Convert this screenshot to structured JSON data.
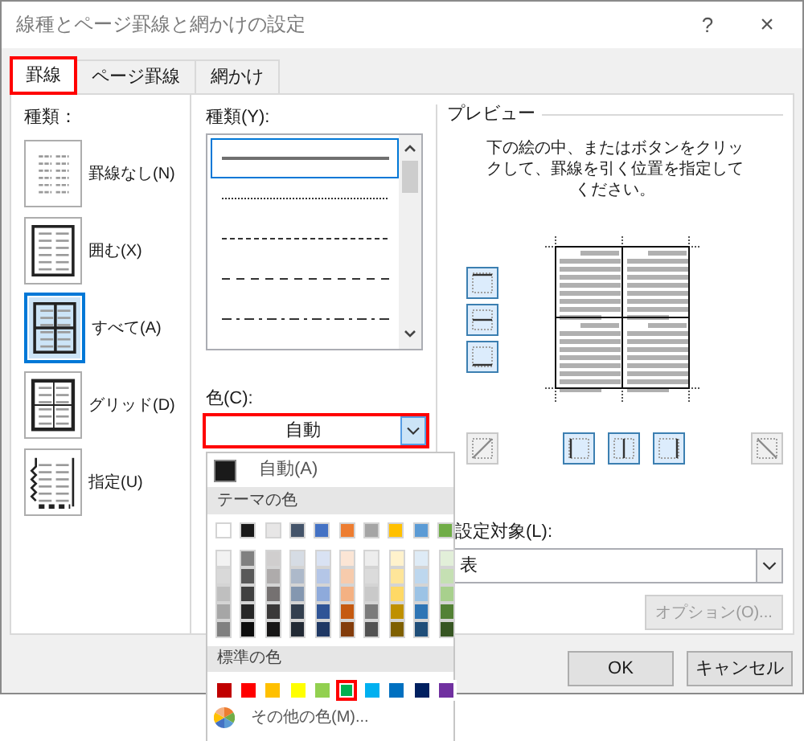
{
  "window": {
    "title": "線種とページ罫線と網かけの設定",
    "help": "?",
    "close": "×"
  },
  "tabs": [
    {
      "label": "罫線",
      "selected": true,
      "highlight": true
    },
    {
      "label": "ページ罫線",
      "selected": false,
      "highlight": false
    },
    {
      "label": "網かけ",
      "selected": false,
      "highlight": false
    }
  ],
  "setting": {
    "label": "種類：",
    "items": [
      {
        "kind": "none",
        "label": "罫線なし(N)",
        "selected": false
      },
      {
        "kind": "box",
        "label": "囲む(X)",
        "selected": false
      },
      {
        "kind": "all",
        "label": "すべて(A)",
        "selected": true
      },
      {
        "kind": "grid",
        "label": "グリッド(D)",
        "selected": false
      },
      {
        "kind": "custom",
        "label": "指定(U)",
        "selected": false
      }
    ]
  },
  "style": {
    "label": "種類(Y):",
    "items": [
      {
        "kind": "solid",
        "selected": true
      },
      {
        "kind": "dotted",
        "selected": false
      },
      {
        "kind": "dashed",
        "selected": false
      },
      {
        "kind": "long-dash",
        "selected": false
      },
      {
        "kind": "dash-dot",
        "selected": false
      }
    ]
  },
  "color": {
    "label": "色(C):",
    "value": "自動",
    "highlight": true,
    "expanded": true
  },
  "color_menu": {
    "automatic": {
      "label": "自動(A)",
      "color": "#1a1a1a",
      "selected": false
    },
    "theme_header": "テーマの色",
    "theme_colors": [
      {
        "color": "#ffffff",
        "selected": false,
        "shades": [
          {
            "color": "#f2f2f2",
            "selected": false
          },
          {
            "color": "#d9d9d9",
            "selected": false
          },
          {
            "color": "#bfbfbf",
            "selected": false
          },
          {
            "color": "#a6a6a6",
            "selected": false
          },
          {
            "color": "#808080",
            "selected": false
          }
        ]
      },
      {
        "color": "#1a1a1a",
        "selected": false,
        "shades": [
          {
            "color": "#808080",
            "selected": false
          },
          {
            "color": "#595959",
            "selected": false
          },
          {
            "color": "#404040",
            "selected": false
          },
          {
            "color": "#262626",
            "selected": false
          },
          {
            "color": "#0d0d0d",
            "selected": false
          }
        ]
      },
      {
        "color": "#e7e6e6",
        "selected": false,
        "shades": [
          {
            "color": "#d0cece",
            "selected": false
          },
          {
            "color": "#aeabab",
            "selected": false
          },
          {
            "color": "#757171",
            "selected": false
          },
          {
            "color": "#3a3838",
            "selected": false
          },
          {
            "color": "#171616",
            "selected": false
          }
        ]
      },
      {
        "color": "#44546a",
        "selected": false,
        "shades": [
          {
            "color": "#d6dce4",
            "selected": false
          },
          {
            "color": "#adb9ca",
            "selected": false
          },
          {
            "color": "#8497b0",
            "selected": false
          },
          {
            "color": "#333f4f",
            "selected": false
          },
          {
            "color": "#222a35",
            "selected": false
          }
        ]
      },
      {
        "color": "#4472c4",
        "selected": false,
        "shades": [
          {
            "color": "#d9e2f3",
            "selected": false
          },
          {
            "color": "#b4c6e7",
            "selected": false
          },
          {
            "color": "#8eaadb",
            "selected": false
          },
          {
            "color": "#2f5496",
            "selected": false
          },
          {
            "color": "#1f3864",
            "selected": false
          }
        ]
      },
      {
        "color": "#ed7d31",
        "selected": false,
        "shades": [
          {
            "color": "#fbe5d5",
            "selected": false
          },
          {
            "color": "#f7cbac",
            "selected": false
          },
          {
            "color": "#f4b183",
            "selected": false
          },
          {
            "color": "#c55a11",
            "selected": false
          },
          {
            "color": "#833c0b",
            "selected": false
          }
        ]
      },
      {
        "color": "#a5a5a5",
        "selected": false,
        "shades": [
          {
            "color": "#ededed",
            "selected": false
          },
          {
            "color": "#dbdbdb",
            "selected": false
          },
          {
            "color": "#c9c9c9",
            "selected": false
          },
          {
            "color": "#7b7b7b",
            "selected": false
          },
          {
            "color": "#525252",
            "selected": false
          }
        ]
      },
      {
        "color": "#ffc000",
        "selected": false,
        "shades": [
          {
            "color": "#fff2cc",
            "selected": false
          },
          {
            "color": "#fee599",
            "selected": false
          },
          {
            "color": "#ffd965",
            "selected": false
          },
          {
            "color": "#bf9000",
            "selected": false
          },
          {
            "color": "#7f6000",
            "selected": false
          }
        ]
      },
      {
        "color": "#5b9bd5",
        "selected": false,
        "shades": [
          {
            "color": "#deebf6",
            "selected": false
          },
          {
            "color": "#bdd7ee",
            "selected": false
          },
          {
            "color": "#9cc3e5",
            "selected": false
          },
          {
            "color": "#2e75b5",
            "selected": false
          },
          {
            "color": "#1f4e79",
            "selected": false
          }
        ]
      },
      {
        "color": "#70ad47",
        "selected": false,
        "shades": [
          {
            "color": "#e2efd9",
            "selected": false
          },
          {
            "color": "#c5e0b3",
            "selected": false
          },
          {
            "color": "#a8d08d",
            "selected": false
          },
          {
            "color": "#538135",
            "selected": false
          },
          {
            "color": "#375623",
            "selected": false
          }
        ]
      }
    ],
    "standard_header": "標準の色",
    "standard_colors": [
      {
        "color": "#c00000",
        "selected": false,
        "highlight": false
      },
      {
        "color": "#ff0000",
        "selected": false,
        "highlight": false
      },
      {
        "color": "#ffc000",
        "selected": false,
        "highlight": false
      },
      {
        "color": "#ffff00",
        "selected": false,
        "highlight": false
      },
      {
        "color": "#92d050",
        "selected": false,
        "highlight": false
      },
      {
        "color": "#00b050",
        "selected": true,
        "highlight": true
      },
      {
        "color": "#00b0f0",
        "selected": false,
        "highlight": false
      },
      {
        "color": "#0070c0",
        "selected": false,
        "highlight": false
      },
      {
        "color": "#002060",
        "selected": false,
        "highlight": false
      },
      {
        "color": "#7030a0",
        "selected": false,
        "highlight": false
      }
    ],
    "more": "その他の色(M)..."
  },
  "preview": {
    "label": "プレビュー",
    "hint": "下の絵の中、またはボタンをクリックして、罫線を引く位置を指定してください。",
    "side_buttons": [
      {
        "kind": "top",
        "on": true
      },
      {
        "kind": "middle",
        "on": true
      },
      {
        "kind": "bottom",
        "on": true
      }
    ],
    "bottom_buttons": [
      {
        "kind": "diag-up",
        "on": false
      },
      {
        "kind": "left",
        "on": true
      },
      {
        "kind": "center",
        "on": true
      },
      {
        "kind": "right",
        "on": true
      },
      {
        "kind": "diag-down",
        "on": false
      }
    ]
  },
  "apply_to": {
    "label": "設定対象(L):",
    "value": "表"
  },
  "options_button": {
    "label": "オプション(O)...",
    "disabled": true
  },
  "buttons": [
    {
      "label": "OK"
    },
    {
      "label": "キャンセル"
    }
  ]
}
